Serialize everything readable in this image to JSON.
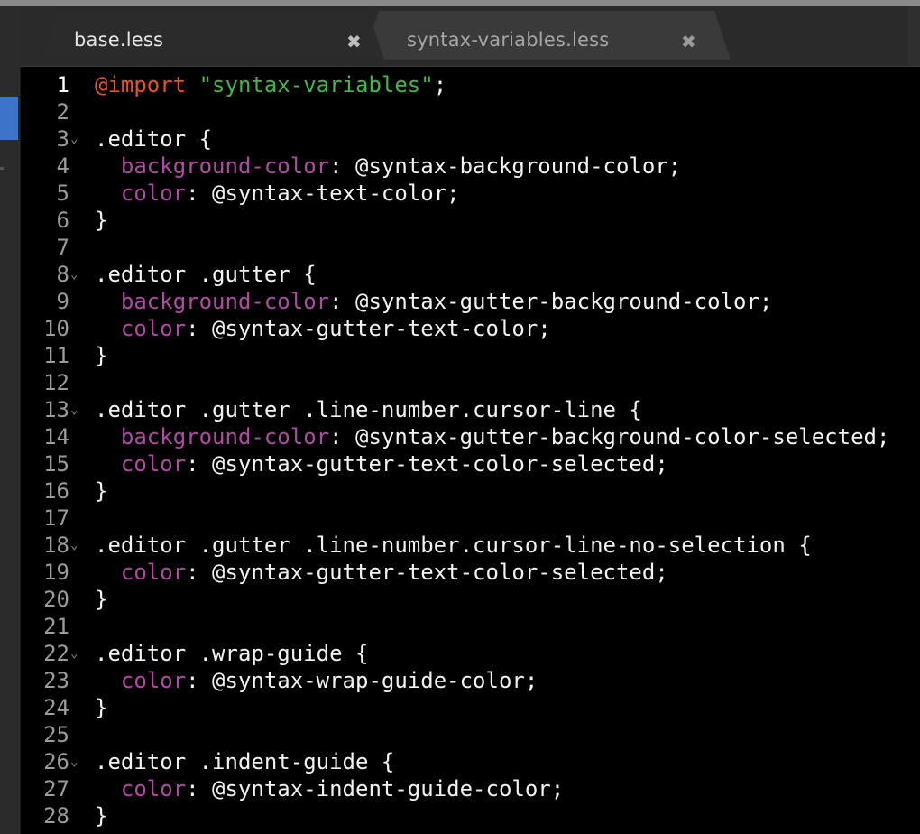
{
  "tabs": [
    {
      "label": "base.less",
      "active": true,
      "close": "✖"
    },
    {
      "label": "syntax-variables.less",
      "active": false,
      "close": "✖"
    }
  ],
  "colors": {
    "keyword": "#e8541b",
    "string": "#3fb948",
    "property": "#b04aa3",
    "text": "#f2f2f2",
    "gutter": "#9b9b9b",
    "background": "#000000",
    "selection_marker": "#3d74c9"
  },
  "icons": {
    "fold": "chevron-down-icon",
    "close": "close-icon"
  },
  "editor": {
    "lines": [
      {
        "num": "1",
        "fold": "",
        "segments": [
          {
            "t": "@import",
            "c": "kw"
          },
          {
            "t": " ",
            "c": "plain"
          },
          {
            "t": "\"syntax-variables\"",
            "c": "str"
          },
          {
            "t": ";",
            "c": "plain"
          }
        ]
      },
      {
        "num": "2",
        "fold": "",
        "segments": []
      },
      {
        "num": "3",
        "fold": "⌄",
        "segments": [
          {
            "t": ".editor {",
            "c": "plain"
          }
        ]
      },
      {
        "num": "4",
        "fold": "",
        "segments": [
          {
            "t": "  ",
            "c": "plain"
          },
          {
            "t": "background-color",
            "c": "prop"
          },
          {
            "t": ": @syntax-background-color;",
            "c": "plain"
          }
        ]
      },
      {
        "num": "5",
        "fold": "",
        "segments": [
          {
            "t": "  ",
            "c": "plain"
          },
          {
            "t": "color",
            "c": "prop"
          },
          {
            "t": ": @syntax-text-color;",
            "c": "plain"
          }
        ]
      },
      {
        "num": "6",
        "fold": "",
        "segments": [
          {
            "t": "}",
            "c": "plain"
          }
        ]
      },
      {
        "num": "7",
        "fold": "",
        "segments": []
      },
      {
        "num": "8",
        "fold": "⌄",
        "segments": [
          {
            "t": ".editor .gutter {",
            "c": "plain"
          }
        ]
      },
      {
        "num": "9",
        "fold": "",
        "segments": [
          {
            "t": "  ",
            "c": "plain"
          },
          {
            "t": "background-color",
            "c": "prop"
          },
          {
            "t": ": @syntax-gutter-background-color;",
            "c": "plain"
          }
        ]
      },
      {
        "num": "10",
        "fold": "",
        "segments": [
          {
            "t": "  ",
            "c": "plain"
          },
          {
            "t": "color",
            "c": "prop"
          },
          {
            "t": ": @syntax-gutter-text-color;",
            "c": "plain"
          }
        ]
      },
      {
        "num": "11",
        "fold": "",
        "segments": [
          {
            "t": "}",
            "c": "plain"
          }
        ]
      },
      {
        "num": "12",
        "fold": "",
        "segments": []
      },
      {
        "num": "13",
        "fold": "⌄",
        "segments": [
          {
            "t": ".editor .gutter .line-number.cursor-line {",
            "c": "plain"
          }
        ]
      },
      {
        "num": "14",
        "fold": "",
        "segments": [
          {
            "t": "  ",
            "c": "plain"
          },
          {
            "t": "background-color",
            "c": "prop"
          },
          {
            "t": ": @syntax-gutter-background-color-selected;",
            "c": "plain"
          }
        ]
      },
      {
        "num": "15",
        "fold": "",
        "segments": [
          {
            "t": "  ",
            "c": "plain"
          },
          {
            "t": "color",
            "c": "prop"
          },
          {
            "t": ": @syntax-gutter-text-color-selected;",
            "c": "plain"
          }
        ]
      },
      {
        "num": "16",
        "fold": "",
        "segments": [
          {
            "t": "}",
            "c": "plain"
          }
        ]
      },
      {
        "num": "17",
        "fold": "",
        "segments": []
      },
      {
        "num": "18",
        "fold": "⌄",
        "segments": [
          {
            "t": ".editor .gutter .line-number.cursor-line-no-selection {",
            "c": "plain"
          }
        ]
      },
      {
        "num": "19",
        "fold": "",
        "segments": [
          {
            "t": "  ",
            "c": "plain"
          },
          {
            "t": "color",
            "c": "prop"
          },
          {
            "t": ": @syntax-gutter-text-color-selected;",
            "c": "plain"
          }
        ]
      },
      {
        "num": "20",
        "fold": "",
        "segments": [
          {
            "t": "}",
            "c": "plain"
          }
        ]
      },
      {
        "num": "21",
        "fold": "",
        "segments": []
      },
      {
        "num": "22",
        "fold": "⌄",
        "segments": [
          {
            "t": ".editor .wrap-guide {",
            "c": "plain"
          }
        ]
      },
      {
        "num": "23",
        "fold": "",
        "segments": [
          {
            "t": "  ",
            "c": "plain"
          },
          {
            "t": "color",
            "c": "prop"
          },
          {
            "t": ": @syntax-wrap-guide-color;",
            "c": "plain"
          }
        ]
      },
      {
        "num": "24",
        "fold": "",
        "segments": [
          {
            "t": "}",
            "c": "plain"
          }
        ]
      },
      {
        "num": "25",
        "fold": "",
        "segments": []
      },
      {
        "num": "26",
        "fold": "⌄",
        "segments": [
          {
            "t": ".editor .indent-guide {",
            "c": "plain"
          }
        ]
      },
      {
        "num": "27",
        "fold": "",
        "segments": [
          {
            "t": "  ",
            "c": "plain"
          },
          {
            "t": "color",
            "c": "prop"
          },
          {
            "t": ": @syntax-indent-guide-color;",
            "c": "plain"
          }
        ]
      },
      {
        "num": "28",
        "fold": "",
        "segments": [
          {
            "t": "}",
            "c": "plain"
          }
        ]
      }
    ]
  }
}
